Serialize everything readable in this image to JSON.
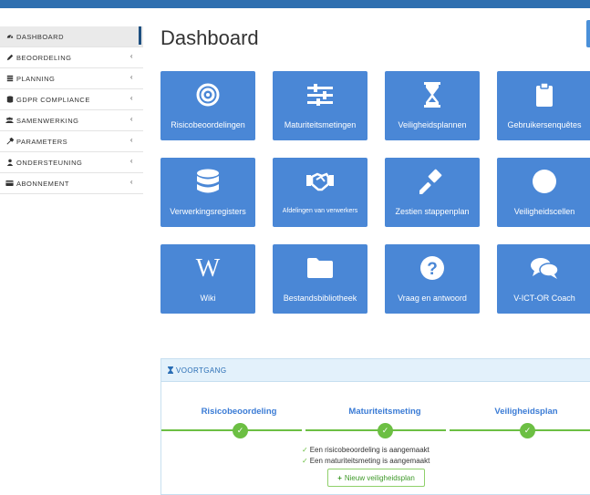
{
  "sidebar": {
    "items": [
      {
        "label": "DASHBOARD",
        "icon": "dashboard-icon",
        "active": true
      },
      {
        "label": "BEOORDELING",
        "icon": "pencil-icon"
      },
      {
        "label": "PLANNING",
        "icon": "list-icon"
      },
      {
        "label": "GDPR COMPLIANCE",
        "icon": "database-icon"
      },
      {
        "label": "SAMENWERKING",
        "icon": "users-icon"
      },
      {
        "label": "PARAMETERS",
        "icon": "wrench-icon"
      },
      {
        "label": "ONDERSTEUNING",
        "icon": "user-icon"
      },
      {
        "label": "ABONNEMENT",
        "icon": "card-icon"
      }
    ],
    "chevron": "‹"
  },
  "header": {
    "title": "Dashboard"
  },
  "tiles": [
    {
      "label": "Risicobeoordelingen",
      "icon": "target-icon"
    },
    {
      "label": "Maturiteitsmetingen",
      "icon": "sliders-icon"
    },
    {
      "label": "Veiligheidsplannen",
      "icon": "hourglass-icon"
    },
    {
      "label": "Gebruikersenquêtes",
      "icon": "clipboard-icon"
    },
    {
      "label": "Verwerkingsregisters",
      "icon": "database-icon"
    },
    {
      "label": "Afdelingen van verwerkers",
      "icon": "handshake-icon"
    },
    {
      "label": "Zestien stappenplan",
      "icon": "gavel-icon"
    },
    {
      "label": "Veiligheidscellen",
      "icon": "circle-icon"
    },
    {
      "label": "Wiki",
      "icon": "wikipedia-icon"
    },
    {
      "label": "Bestandsbibliotheek",
      "icon": "folder-icon"
    },
    {
      "label": "Vraag en antwoord",
      "icon": "question-icon"
    },
    {
      "label": "V-ICT-OR Coach",
      "icon": "comments-icon"
    }
  ],
  "progress": {
    "title": "VOORTGANG",
    "steps": [
      {
        "label": "Risicobeoordeling",
        "done": true
      },
      {
        "label": "Maturiteitsmeting",
        "done": true
      },
      {
        "label": "Veiligheidsplan",
        "done": true
      }
    ],
    "check": "✓",
    "messages": [
      "Een risicobeoordeling is aangemaakt",
      "Een maturiteitsmeting is aangemaakt"
    ],
    "new_button": "Nieuw veiligheidsplan",
    "new_button_plus": "+"
  },
  "colors": {
    "tile": "#4a87d6",
    "accent": "#2f6fb0",
    "success": "#6cbf43"
  }
}
